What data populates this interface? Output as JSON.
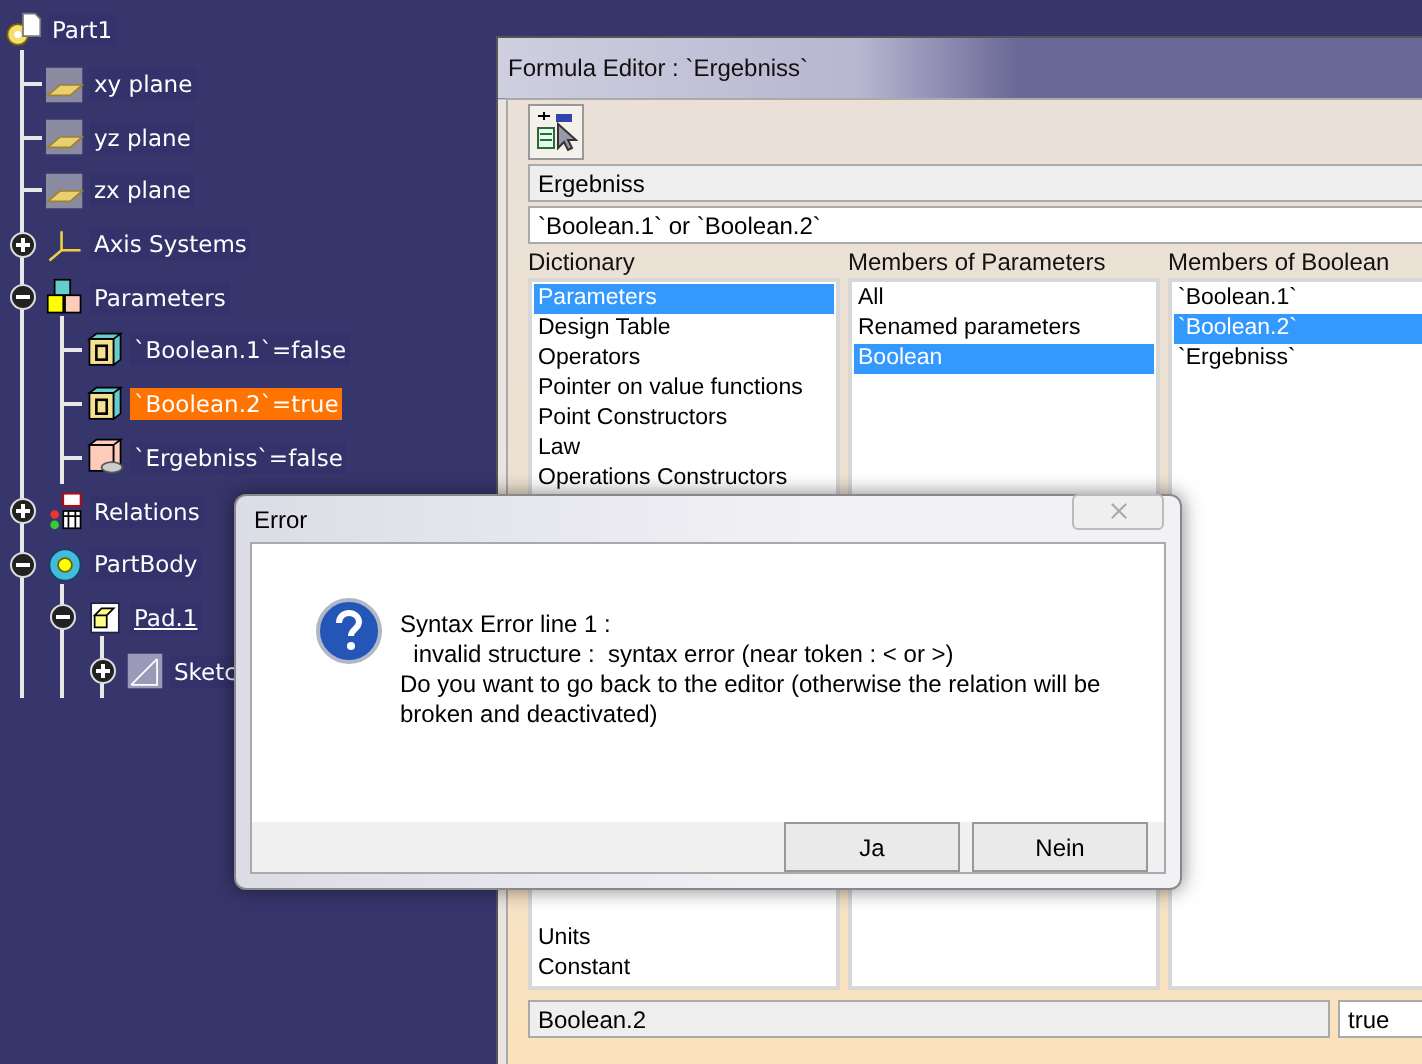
{
  "tree": [
    {
      "label": "Part1",
      "kind": "part",
      "selected": false,
      "children": [
        {
          "label": "xy plane",
          "kind": "plane",
          "selected": false
        },
        {
          "label": "yz plane",
          "kind": "plane",
          "selected": false
        },
        {
          "label": "zx plane",
          "kind": "plane",
          "selected": false
        },
        {
          "label": "Axis Systems",
          "kind": "axis",
          "selected": false,
          "expanded": false
        },
        {
          "label": "Parameters",
          "kind": "parameters",
          "selected": false,
          "expanded": true,
          "children": [
            {
              "label": "`Boolean.1`=false",
              "kind": "boolean",
              "selected": false
            },
            {
              "label": "`Boolean.2`=true",
              "kind": "boolean",
              "selected": true
            },
            {
              "label": "`Ergebniss`=false",
              "kind": "formula",
              "selected": false
            }
          ]
        },
        {
          "label": "Relations",
          "kind": "relations",
          "selected": false,
          "expanded": false
        },
        {
          "label": "PartBody",
          "kind": "body",
          "selected": false,
          "expanded": true,
          "children": [
            {
              "label": "Pad.1",
              "kind": "pad",
              "selected": false,
              "expanded": true,
              "children": [
                {
                  "label": "Sketc",
                  "kind": "sketch",
                  "selected": false,
                  "expanded": false
                }
              ]
            }
          ]
        }
      ]
    }
  ],
  "formula_editor": {
    "title": "Formula Editor : `Ergebniss`",
    "parameter": "Ergebniss",
    "formula": "`Boolean.1` or `Boolean.2`",
    "lists": [
      {
        "label": "Dictionary",
        "items": [
          {
            "label": "Parameters",
            "selected": true
          },
          {
            "label": "Design Table",
            "selected": false
          },
          {
            "label": "Operators",
            "selected": false
          },
          {
            "label": "Pointer on value functions",
            "selected": false
          },
          {
            "label": "Point Constructors",
            "selected": false
          },
          {
            "label": "Law",
            "selected": false
          },
          {
            "label": "Operations Constructors",
            "selected": false
          }
        ],
        "bottom_items": [
          {
            "label": "Units",
            "selected": false
          },
          {
            "label": "Constant",
            "selected": false
          }
        ]
      },
      {
        "label": "Members of Parameters",
        "items": [
          {
            "label": "All",
            "selected": false
          },
          {
            "label": "Renamed parameters",
            "selected": false
          },
          {
            "label": "Boolean",
            "selected": true
          }
        ]
      },
      {
        "label": "Members of Boolean",
        "items": [
          {
            "label": "`Boolean.1`",
            "selected": false
          },
          {
            "label": "`Boolean.2`",
            "selected": true
          },
          {
            "label": "`Ergebniss`",
            "selected": false
          }
        ]
      }
    ],
    "selected_member": "Boolean.2",
    "value": "true"
  },
  "error_dialog": {
    "title": "Error",
    "message": [
      "Syntax Error line 1 :",
      "  invalid structure :  syntax error (near token : < or >)",
      "Do you want to go back to the editor (otherwise the relation will be broken and deactivated)"
    ],
    "buttons": [
      "Ja",
      "Nein"
    ]
  }
}
